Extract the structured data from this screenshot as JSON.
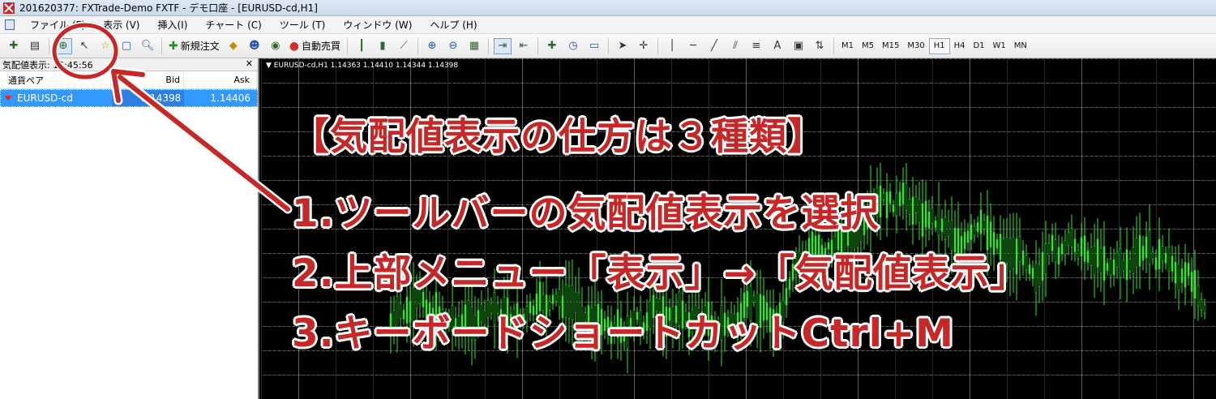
{
  "window": {
    "title": "201620377: FXTrade-Demo FXTF - デモ口座 - [EURUSD-cd,H1]"
  },
  "menu": {
    "items": [
      "ファイル (F)",
      "表示 (V)",
      "挿入(I)",
      "チャート (C)",
      "ツール (T)",
      "ウィンドウ (W)",
      "ヘルプ (H)"
    ]
  },
  "toolbar": {
    "new_order_label": "新規注文",
    "auto_trade_label": "自動売買",
    "timeframes": [
      "M1",
      "M5",
      "M15",
      "M30",
      "H1",
      "H4",
      "D1",
      "W1",
      "MN"
    ],
    "active_timeframe": "H1"
  },
  "market_watch": {
    "title": "気配値表示: 15:45:56",
    "columns": {
      "symbol": "通貨ペア",
      "bid": "Bid",
      "ask": "Ask"
    },
    "rows": [
      {
        "symbol": "EURUSD-cd",
        "bid": "1.14398",
        "ask": "1.14406"
      }
    ]
  },
  "chart": {
    "label": "EURUSD-cd,H1  1.14363 1.14410 1.14344 1.14398",
    "grid_color": "#aaaaaa",
    "candle_color": "#2ee62e"
  },
  "annotation": {
    "heading": "【気配値表示の仕方は３種類】",
    "steps": [
      "1.ツールバーの気配値表示を選択",
      "2.上部メニュー「表示」→「気配値表示」",
      "3.キーボードショートカットCtrl+M"
    ],
    "color": "#c62828"
  }
}
